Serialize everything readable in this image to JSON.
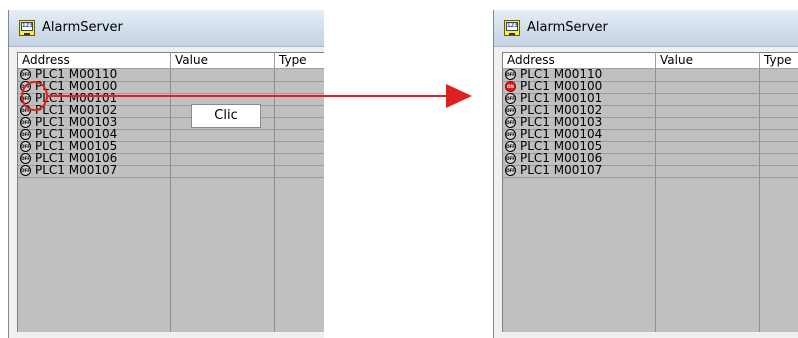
{
  "left_window": {
    "title": "AlarmServer",
    "icon_label": "123",
    "columns": [
      "Address",
      "Value",
      "Type"
    ],
    "rows": [
      {
        "address": "PLC1 M00110",
        "state": "off"
      },
      {
        "address": "PLC1 M00100",
        "state": "off"
      },
      {
        "address": "PLC1 M00101",
        "state": "off"
      },
      {
        "address": "PLC1 M00102",
        "state": "off"
      },
      {
        "address": "PLC1 M00103",
        "state": "off"
      },
      {
        "address": "PLC1 M00104",
        "state": "off"
      },
      {
        "address": "PLC1 M00105",
        "state": "off"
      },
      {
        "address": "PLC1 M00106",
        "state": "off"
      },
      {
        "address": "PLC1 M00107",
        "state": "off"
      }
    ]
  },
  "right_window": {
    "title": "AlarmServer",
    "icon_label": "123",
    "columns": [
      "Address",
      "Value",
      "Type"
    ],
    "rows": [
      {
        "address": "PLC1 M00110",
        "state": "off"
      },
      {
        "address": "PLC1 M00100",
        "state": "on"
      },
      {
        "address": "PLC1 M00101",
        "state": "off"
      },
      {
        "address": "PLC1 M00102",
        "state": "off"
      },
      {
        "address": "PLC1 M00103",
        "state": "off"
      },
      {
        "address": "PLC1 M00104",
        "state": "off"
      },
      {
        "address": "PLC1 M00105",
        "state": "off"
      },
      {
        "address": "PLC1 M00106",
        "state": "off"
      },
      {
        "address": "PLC1 M00107",
        "state": "off"
      }
    ]
  },
  "state_icons": {
    "off": "OFF",
    "on": "ON"
  },
  "annotation": {
    "callout": "Clic",
    "color": "#e02020"
  }
}
